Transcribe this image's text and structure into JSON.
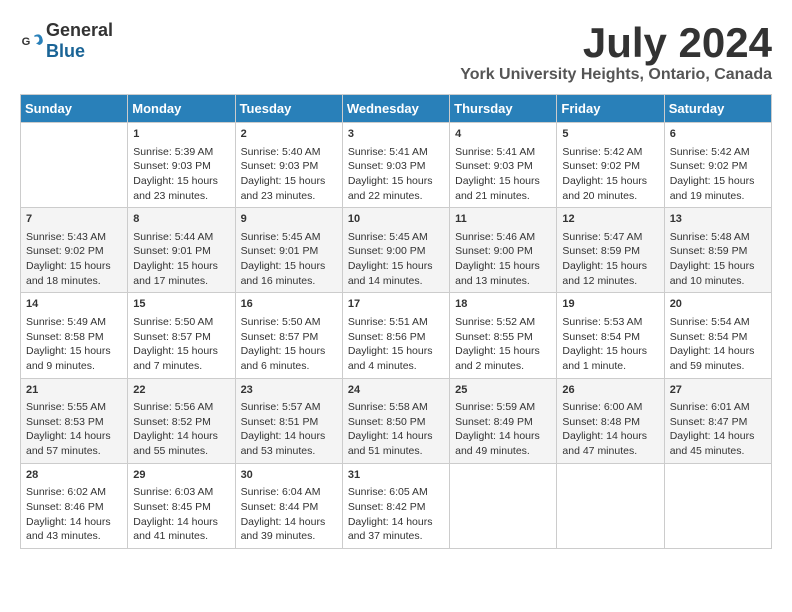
{
  "header": {
    "logo_general": "General",
    "logo_blue": "Blue",
    "month": "July 2024",
    "location": "York University Heights, Ontario, Canada"
  },
  "days_of_week": [
    "Sunday",
    "Monday",
    "Tuesday",
    "Wednesday",
    "Thursday",
    "Friday",
    "Saturday"
  ],
  "weeks": [
    [
      {
        "day": "",
        "content": ""
      },
      {
        "day": "1",
        "content": "Sunrise: 5:39 AM\nSunset: 9:03 PM\nDaylight: 15 hours\nand 23 minutes."
      },
      {
        "day": "2",
        "content": "Sunrise: 5:40 AM\nSunset: 9:03 PM\nDaylight: 15 hours\nand 23 minutes."
      },
      {
        "day": "3",
        "content": "Sunrise: 5:41 AM\nSunset: 9:03 PM\nDaylight: 15 hours\nand 22 minutes."
      },
      {
        "day": "4",
        "content": "Sunrise: 5:41 AM\nSunset: 9:03 PM\nDaylight: 15 hours\nand 21 minutes."
      },
      {
        "day": "5",
        "content": "Sunrise: 5:42 AM\nSunset: 9:02 PM\nDaylight: 15 hours\nand 20 minutes."
      },
      {
        "day": "6",
        "content": "Sunrise: 5:42 AM\nSunset: 9:02 PM\nDaylight: 15 hours\nand 19 minutes."
      }
    ],
    [
      {
        "day": "7",
        "content": "Sunrise: 5:43 AM\nSunset: 9:02 PM\nDaylight: 15 hours\nand 18 minutes."
      },
      {
        "day": "8",
        "content": "Sunrise: 5:44 AM\nSunset: 9:01 PM\nDaylight: 15 hours\nand 17 minutes."
      },
      {
        "day": "9",
        "content": "Sunrise: 5:45 AM\nSunset: 9:01 PM\nDaylight: 15 hours\nand 16 minutes."
      },
      {
        "day": "10",
        "content": "Sunrise: 5:45 AM\nSunset: 9:00 PM\nDaylight: 15 hours\nand 14 minutes."
      },
      {
        "day": "11",
        "content": "Sunrise: 5:46 AM\nSunset: 9:00 PM\nDaylight: 15 hours\nand 13 minutes."
      },
      {
        "day": "12",
        "content": "Sunrise: 5:47 AM\nSunset: 8:59 PM\nDaylight: 15 hours\nand 12 minutes."
      },
      {
        "day": "13",
        "content": "Sunrise: 5:48 AM\nSunset: 8:59 PM\nDaylight: 15 hours\nand 10 minutes."
      }
    ],
    [
      {
        "day": "14",
        "content": "Sunrise: 5:49 AM\nSunset: 8:58 PM\nDaylight: 15 hours\nand 9 minutes."
      },
      {
        "day": "15",
        "content": "Sunrise: 5:50 AM\nSunset: 8:57 PM\nDaylight: 15 hours\nand 7 minutes."
      },
      {
        "day": "16",
        "content": "Sunrise: 5:50 AM\nSunset: 8:57 PM\nDaylight: 15 hours\nand 6 minutes."
      },
      {
        "day": "17",
        "content": "Sunrise: 5:51 AM\nSunset: 8:56 PM\nDaylight: 15 hours\nand 4 minutes."
      },
      {
        "day": "18",
        "content": "Sunrise: 5:52 AM\nSunset: 8:55 PM\nDaylight: 15 hours\nand 2 minutes."
      },
      {
        "day": "19",
        "content": "Sunrise: 5:53 AM\nSunset: 8:54 PM\nDaylight: 15 hours\nand 1 minute."
      },
      {
        "day": "20",
        "content": "Sunrise: 5:54 AM\nSunset: 8:54 PM\nDaylight: 14 hours\nand 59 minutes."
      }
    ],
    [
      {
        "day": "21",
        "content": "Sunrise: 5:55 AM\nSunset: 8:53 PM\nDaylight: 14 hours\nand 57 minutes."
      },
      {
        "day": "22",
        "content": "Sunrise: 5:56 AM\nSunset: 8:52 PM\nDaylight: 14 hours\nand 55 minutes."
      },
      {
        "day": "23",
        "content": "Sunrise: 5:57 AM\nSunset: 8:51 PM\nDaylight: 14 hours\nand 53 minutes."
      },
      {
        "day": "24",
        "content": "Sunrise: 5:58 AM\nSunset: 8:50 PM\nDaylight: 14 hours\nand 51 minutes."
      },
      {
        "day": "25",
        "content": "Sunrise: 5:59 AM\nSunset: 8:49 PM\nDaylight: 14 hours\nand 49 minutes."
      },
      {
        "day": "26",
        "content": "Sunrise: 6:00 AM\nSunset: 8:48 PM\nDaylight: 14 hours\nand 47 minutes."
      },
      {
        "day": "27",
        "content": "Sunrise: 6:01 AM\nSunset: 8:47 PM\nDaylight: 14 hours\nand 45 minutes."
      }
    ],
    [
      {
        "day": "28",
        "content": "Sunrise: 6:02 AM\nSunset: 8:46 PM\nDaylight: 14 hours\nand 43 minutes."
      },
      {
        "day": "29",
        "content": "Sunrise: 6:03 AM\nSunset: 8:45 PM\nDaylight: 14 hours\nand 41 minutes."
      },
      {
        "day": "30",
        "content": "Sunrise: 6:04 AM\nSunset: 8:44 PM\nDaylight: 14 hours\nand 39 minutes."
      },
      {
        "day": "31",
        "content": "Sunrise: 6:05 AM\nSunset: 8:42 PM\nDaylight: 14 hours\nand 37 minutes."
      },
      {
        "day": "",
        "content": ""
      },
      {
        "day": "",
        "content": ""
      },
      {
        "day": "",
        "content": ""
      }
    ]
  ]
}
